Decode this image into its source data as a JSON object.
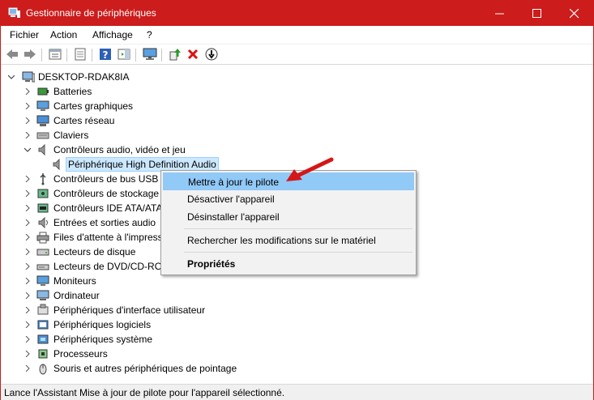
{
  "window": {
    "title": "Gestionnaire de périphériques",
    "title_color": "#cc1c1c"
  },
  "menu": {
    "items": [
      "Fichier",
      "Action",
      "Affichage",
      "?"
    ]
  },
  "toolbar": {
    "icons": [
      "back-icon",
      "forward-icon",
      "tree-view-icon",
      "properties-icon",
      "help-icon",
      "action-pane-icon",
      "monitor-icon",
      "update-driver-icon",
      "uninstall-icon",
      "disable-icon"
    ]
  },
  "tree": {
    "root": "DESKTOP-RDAK8IA",
    "nodes": [
      {
        "label": "Batteries",
        "icon": "battery-icon"
      },
      {
        "label": "Cartes graphiques",
        "icon": "display-adapter-icon"
      },
      {
        "label": "Cartes réseau",
        "icon": "network-adapter-icon"
      },
      {
        "label": "Claviers",
        "icon": "keyboard-icon"
      },
      {
        "label": "Contrôleurs audio, vidéo et jeu",
        "icon": "speaker-icon",
        "expanded": true
      },
      {
        "label": "Périphérique High Definition Audio",
        "icon": "speaker-icon",
        "child": true,
        "selected": true
      },
      {
        "label": "Contrôleurs de bus USB",
        "icon": "usb-icon"
      },
      {
        "label": "Contrôleurs de stockage",
        "icon": "storage-controller-icon"
      },
      {
        "label": "Contrôleurs IDE ATA/ATAPI",
        "icon": "ide-icon"
      },
      {
        "label": "Entrées et sorties audio",
        "icon": "audio-io-icon"
      },
      {
        "label": "Files d'attente à l'impression",
        "icon": "printer-icon"
      },
      {
        "label": "Lecteurs de disque",
        "icon": "disk-drive-icon"
      },
      {
        "label": "Lecteurs de DVD/CD-ROM",
        "icon": "dvd-icon"
      },
      {
        "label": "Moniteurs",
        "icon": "monitor-icon"
      },
      {
        "label": "Ordinateur",
        "icon": "computer-icon"
      },
      {
        "label": "Périphériques d'interface utilisateur",
        "icon": "hid-icon"
      },
      {
        "label": "Périphériques logiciels",
        "icon": "software-device-icon"
      },
      {
        "label": "Périphériques système",
        "icon": "system-device-icon"
      },
      {
        "label": "Processeurs",
        "icon": "processor-icon"
      },
      {
        "label": "Souris et autres périphériques de pointage",
        "icon": "mouse-icon"
      }
    ]
  },
  "context_menu": {
    "items": [
      {
        "label": "Mettre à jour le pilote",
        "highlighted": true
      },
      {
        "label": "Désactiver l'appareil"
      },
      {
        "label": "Désinstaller l'appareil"
      },
      {
        "label": "Rechercher les modifications sur le matériel"
      },
      {
        "label": "Propriétés",
        "bold": true
      }
    ]
  },
  "status": {
    "text": "Lance l'Assistant Mise à jour de pilote pour l'appareil sélectionné."
  },
  "annotation": {
    "arrow_color": "#d41717"
  }
}
